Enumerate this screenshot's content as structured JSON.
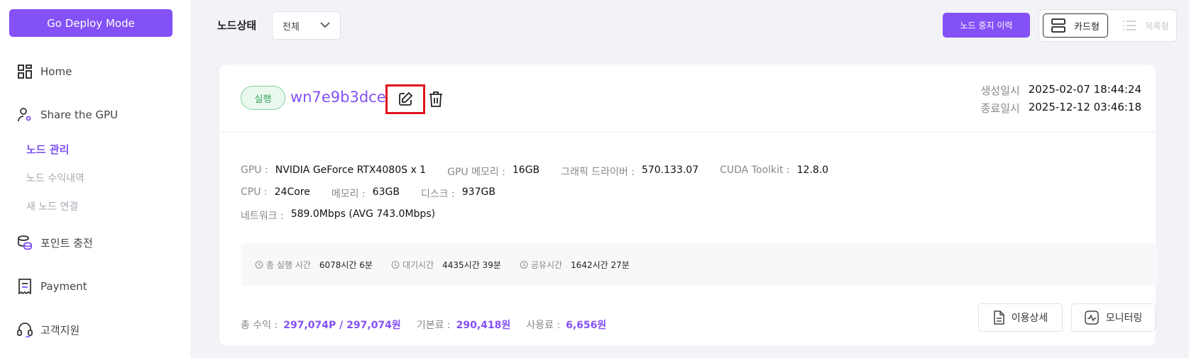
{
  "sidebar": {
    "deploy_label": "Go Deploy Mode",
    "items": [
      {
        "label": "Home",
        "icon": "dashboard-icon"
      },
      {
        "label": "Share the GPU",
        "icon": "user-gear-icon"
      },
      {
        "label": "포인트 충전",
        "icon": "coins-icon"
      },
      {
        "label": "Payment",
        "icon": "receipt-icon"
      },
      {
        "label": "고객지원",
        "icon": "headset-icon"
      }
    ],
    "sub_items": [
      {
        "label": "노드 관리",
        "active": true
      },
      {
        "label": "노드 수익내역",
        "active": false
      },
      {
        "label": "새 노드 연결",
        "active": false
      }
    ]
  },
  "topbar": {
    "status_label": "노드상태",
    "status_value": "전체",
    "history_button": "노드 중지 이력",
    "view_card": "카드형",
    "view_list": "목록형"
  },
  "node": {
    "status": "실행",
    "name": "wn7e9b3dce",
    "created_label": "생성일시",
    "created": "2025-02-07 18:44:24",
    "ended_label": "종료일시",
    "ended": "2025-12-12 03:46:18",
    "specs_row1": [
      {
        "k": "GPU :",
        "v": "NVIDIA GeForce RTX4080S x 1"
      },
      {
        "k": "GPU 메모리 :",
        "v": "16GB"
      },
      {
        "k": "그래픽 드라이버 :",
        "v": "570.133.07"
      },
      {
        "k": "CUDA Toolkit :",
        "v": "12.8.0"
      }
    ],
    "specs_row2": [
      {
        "k": "CPU :",
        "v": "24Core"
      },
      {
        "k": "메모리 :",
        "v": "63GB"
      },
      {
        "k": "디스크 :",
        "v": "937GB"
      }
    ],
    "specs_row3": [
      {
        "k": "네트워크 :",
        "v": "589.0Mbps (AVG 743.0Mbps)"
      }
    ],
    "stats": [
      {
        "k": "총 실행 시간",
        "v": "6078시간 6분"
      },
      {
        "k": "대기시간",
        "v": "4435시간 39분"
      },
      {
        "k": "공유시간",
        "v": "1642시간 27분"
      }
    ],
    "earnings": [
      {
        "k": "총 수익 :",
        "v": "297,074P / 297,074원"
      },
      {
        "k": "기본료 :",
        "v": "290,418원"
      },
      {
        "k": "사용료 :",
        "v": "6,656원"
      }
    ],
    "usage_button": "이용상세",
    "monitor_button": "모니터링"
  },
  "colors": {
    "accent": "#8451f6",
    "running": "#34a65a",
    "highlight": "#e0141e"
  }
}
